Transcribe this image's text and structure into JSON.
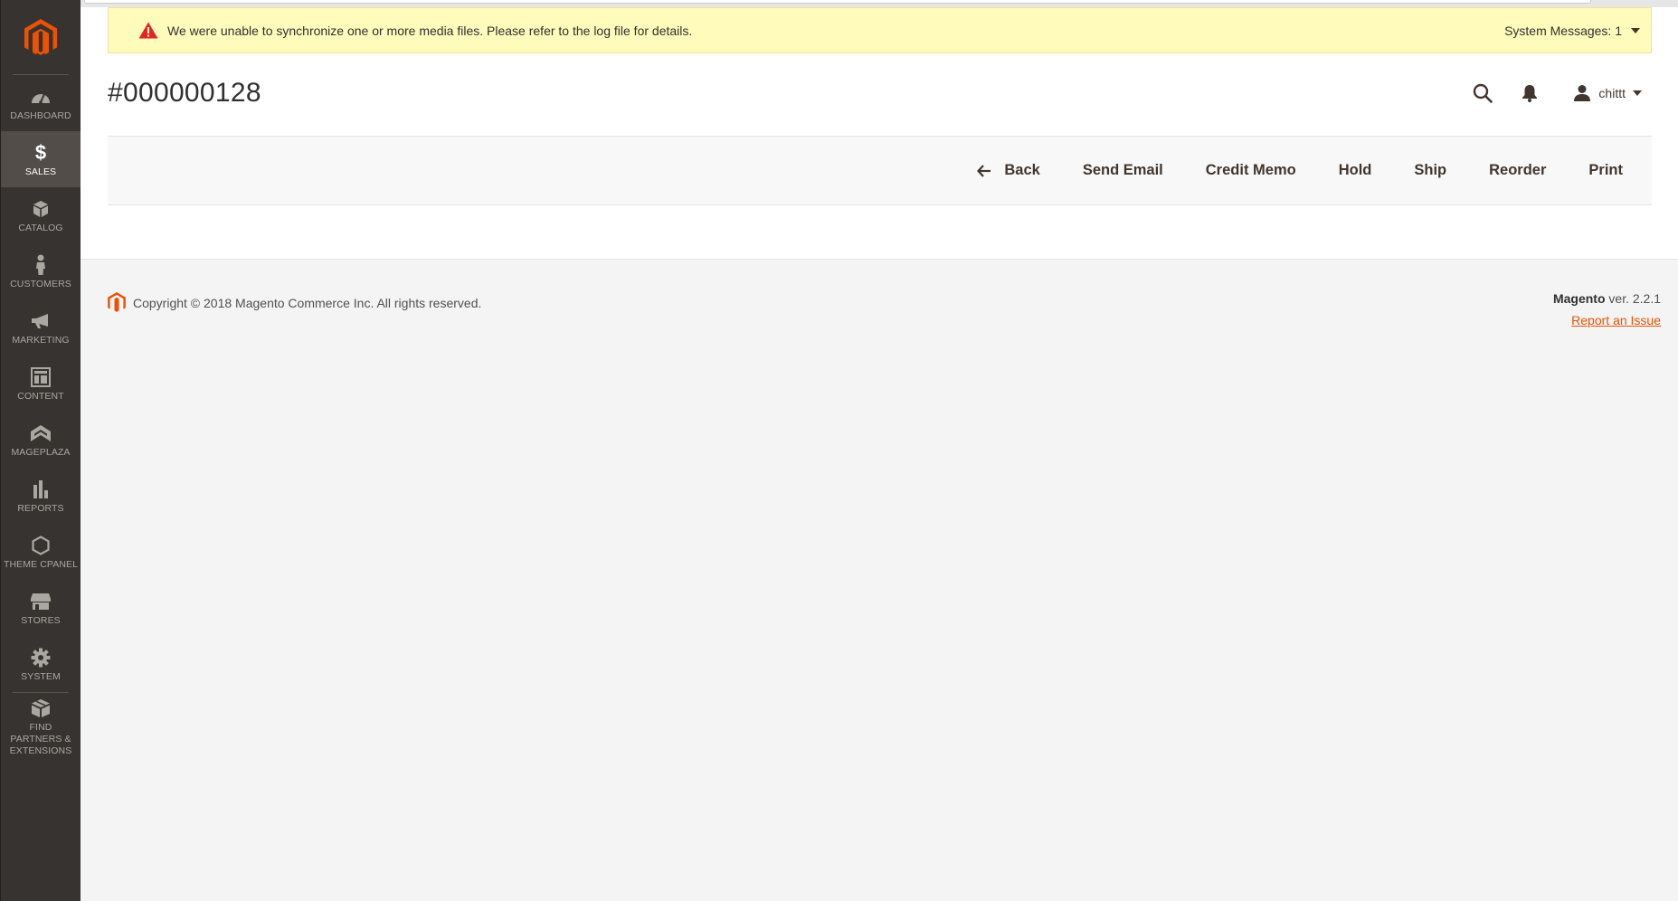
{
  "sidebar": {
    "logo": "magento-logo",
    "items": [
      {
        "label": "Dashboard",
        "icon": "dashboard-icon",
        "active": false
      },
      {
        "label": "Sales",
        "icon": "dollar-icon",
        "active": true
      },
      {
        "label": "Catalog",
        "icon": "cube-icon",
        "active": false
      },
      {
        "label": "Customers",
        "icon": "person-icon",
        "active": false
      },
      {
        "label": "Marketing",
        "icon": "megaphone-icon",
        "active": false
      },
      {
        "label": "Content",
        "icon": "layout-icon",
        "active": false
      },
      {
        "label": "Mageplaza",
        "icon": "mageplaza-icon",
        "active": false
      },
      {
        "label": "Reports",
        "icon": "bar-chart-icon",
        "active": false
      },
      {
        "label": "Theme Cpanel",
        "icon": "hexagon-icon",
        "active": false
      },
      {
        "label": "Stores",
        "icon": "store-icon",
        "active": false
      },
      {
        "label": "System",
        "icon": "gear-icon",
        "active": false
      },
      {
        "label": "Find Partners & Extensions",
        "icon": "box-icon",
        "active": false
      }
    ]
  },
  "system_message": {
    "text": "We were unable to synchronize one or more media files. Please refer to the log file for details.",
    "right_label": "System Messages: 1"
  },
  "header": {
    "title": "#000000128",
    "user_name": "chittt"
  },
  "toolbar": {
    "back": "Back",
    "send_email": "Send Email",
    "credit_memo": "Credit Memo",
    "hold": "Hold",
    "ship": "Ship",
    "reorder": "Reorder",
    "print": "Print"
  },
  "footer": {
    "copyright": "Copyright © 2018 Magento Commerce Inc. All rights reserved.",
    "brand": "Magento",
    "version": "ver. 2.2.1",
    "report_link": "Report an Issue"
  },
  "colors": {
    "brand_orange": "#eb5202",
    "sidebar_bg": "#373330",
    "notice_bg": "#fffbbb"
  }
}
